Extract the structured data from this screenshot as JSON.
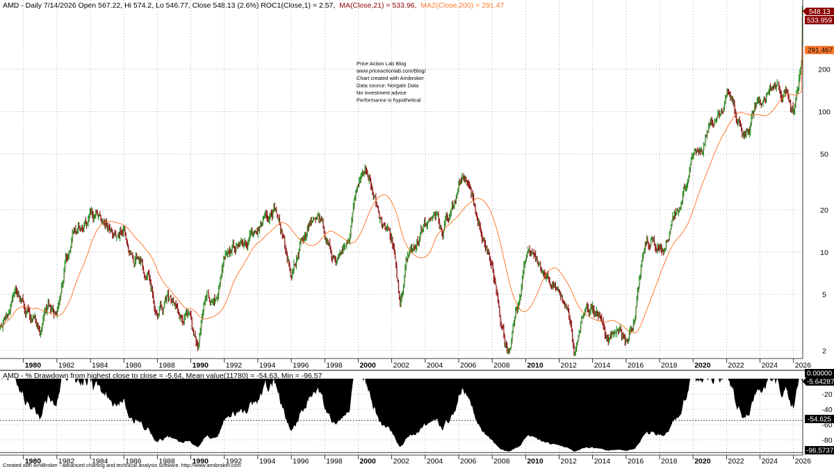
{
  "header": {
    "top_title_left": "AMD - Daily 7/14/2026 Open 567.22, Hi 574.2, Lo 546.77, Close 548.13 (2.6%) ROC1(Close,1) = 2.57,",
    "top_title_ma": "MA(Close,21) = 533.96,",
    "top_title_ma2": "MA2(Close,200) = 291.47",
    "bottom_title": "AMD - % Drawdown from highest close to close  = -5.64,   Mean value(11780) = -54.63, Min  = -96.57",
    "footer": "Created with AmiBroker - advanced charting and technical analysis software. http://www.amibroker.com"
  },
  "colors": {
    "up_bar": "#1f8f1f",
    "down_bar": "#8b1010",
    "ma21": "#8b0000",
    "ma200": "#ff7a2e",
    "drawdown_fill": "#000000",
    "grid": "#9a9a9a",
    "label_price_bg": "#8b0000",
    "label_ma200_bg": "#ff7a2e",
    "label_dd_bg": "#000000"
  },
  "annotation": {
    "lines": [
      "Price Action Lab Blog",
      "www.priceactionlab.com/Blog/",
      "Chart created with Amibroker",
      "Data source: Norgate Data",
      "No investment advice",
      "Performance is hypothetical"
    ]
  },
  "chart_data": [
    {
      "type": "candlestick",
      "panel": "price",
      "yscale": "log",
      "ylim": [
        1.75,
        620
      ],
      "xlim": [
        1978.6,
        2026.55
      ],
      "x_ticks": [
        "1980",
        "1982",
        "1984",
        "1986",
        "1988",
        "1990",
        "1992",
        "1994",
        "1996",
        "1998",
        "2000",
        "2002",
        "2004",
        "2006",
        "2008",
        "2010",
        "2012",
        "2014",
        "2016",
        "2018",
        "2020",
        "2022",
        "2024",
        "2026"
      ],
      "y_ticks": [
        "2",
        "5",
        "10",
        "20",
        "50",
        "100",
        "200"
      ],
      "y_tick_values": [
        2,
        5,
        10,
        20,
        50,
        100,
        200
      ],
      "price_anchors": {
        "x": [
          1978.6,
          1979.0,
          1979.5,
          1980.0,
          1980.5,
          1981.0,
          1981.5,
          1982.0,
          1982.5,
          1983.0,
          1983.5,
          1984.0,
          1984.5,
          1985.0,
          1985.5,
          1986.0,
          1986.5,
          1987.0,
          1987.5,
          1987.9,
          1988.5,
          1989.0,
          1989.5,
          1990.0,
          1990.4,
          1990.8,
          1991.5,
          1992.0,
          1992.5,
          1993.0,
          1993.5,
          1994.0,
          1994.5,
          1995.0,
          1995.5,
          1996.0,
          1996.5,
          1997.0,
          1997.5,
          1998.0,
          1998.5,
          1999.0,
          1999.5,
          2000.0,
          2000.5,
          2001.0,
          2001.5,
          2002.0,
          2002.5,
          2003.0,
          2003.5,
          2004.0,
          2004.5,
          2005.0,
          2005.5,
          2006.0,
          2006.5,
          2007.0,
          2007.5,
          2008.0,
          2008.5,
          2008.9,
          2009.5,
          2010.0,
          2010.5,
          2011.0,
          2011.5,
          2012.0,
          2012.5,
          2012.9,
          2013.5,
          2014.0,
          2014.5,
          2015.0,
          2015.5,
          2016.0,
          2016.5,
          2017.0,
          2017.5,
          2018.0,
          2018.5,
          2019.0,
          2019.5,
          2020.0,
          2020.5,
          2021.0,
          2021.5,
          2022.0,
          2022.5,
          2023.0,
          2023.5,
          2024.0,
          2024.5,
          2025.0,
          2025.5,
          2026.0,
          2026.54
        ],
        "close": [
          3.0,
          3.5,
          5.5,
          4.5,
          3.5,
          2.8,
          4.0,
          4.0,
          9.0,
          15,
          16,
          18,
          16,
          15,
          13,
          15,
          9.0,
          8.5,
          7.0,
          4.0,
          4.5,
          4.2,
          3.5,
          3.5,
          2.2,
          5.0,
          4.5,
          9.0,
          10,
          12,
          13,
          15,
          17,
          19,
          13,
          6.5,
          11,
          17,
          19,
          12,
          8.5,
          10,
          14,
          32,
          35,
          25,
          15,
          12,
          5.0,
          10,
          13,
          15,
          17,
          14,
          18,
          30,
          35,
          22,
          14,
          8.0,
          3.0,
          2.0,
          4.0,
          9.0,
          8.5,
          7.0,
          6.0,
          5.5,
          4.5,
          2.2,
          4.0,
          4.0,
          3.6,
          2.5,
          2.5,
          2.2,
          3.8,
          10,
          13,
          12,
          12,
          20,
          30,
          45,
          55,
          80,
          90,
          130,
          100,
          70,
          90,
          110,
          160,
          140,
          140,
          100,
          250,
          400,
          548.13
        ]
      },
      "ma21_last": 533.96,
      "ma200_last": 291.47,
      "last_close": 548.13
    },
    {
      "type": "area",
      "panel": "drawdown",
      "ylim": [
        -100,
        0
      ],
      "xlim": [
        1978.6,
        2026.55
      ],
      "x_ticks": [
        "1980",
        "1982",
        "1984",
        "1986",
        "1988",
        "1990",
        "1992",
        "1994",
        "1996",
        "1998",
        "2000",
        "2002",
        "2004",
        "2006",
        "2008",
        "2010",
        "2012",
        "2014",
        "2016",
        "2018",
        "2020",
        "2022",
        "2024",
        "2026"
      ],
      "y_ticks": [
        "-20",
        "-40",
        "-60",
        "-80"
      ],
      "y_tick_values": [
        -20,
        -40,
        -60,
        -80
      ],
      "mean": -54.625,
      "min": -96.5737,
      "last": -5.64287,
      "labels": {
        "zero": "0.00000",
        "last": "-5.64287",
        "mean": "-54.625",
        "min": "-96.5737"
      }
    }
  ],
  "price_labels": {
    "close": "548.13",
    "ma21": "533.959",
    "ma200": "291.467"
  }
}
